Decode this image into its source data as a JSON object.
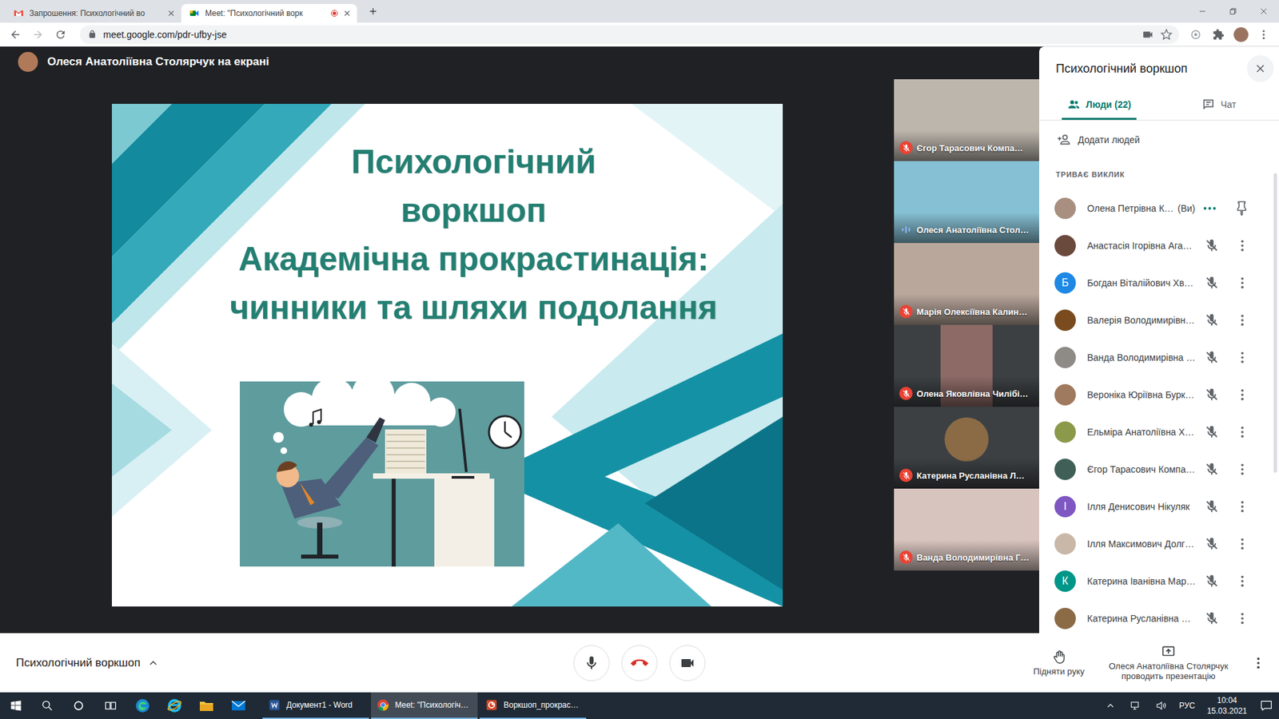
{
  "browser": {
    "tabs": [
      {
        "label": "Запрошення: Психологічний во",
        "kind": "gmail",
        "selected": false,
        "recording": false
      },
      {
        "label": "Meet: \"Психологічний ворк",
        "kind": "meet",
        "selected": true,
        "recording": true
      }
    ],
    "url": "meet.google.com/pdr-ufby-jse"
  },
  "meeting": {
    "presenter_label": "Олеся Анатоліївна Столярчук на екрані",
    "presenter_color": "#b07a5a"
  },
  "slide": {
    "title_lines": [
      "Психологічний",
      "воркшоп",
      "Академічна прокрастинація:",
      "чинники та шляхи подолання"
    ]
  },
  "tiles": [
    {
      "name": "Єгор Тарасович Компа…",
      "kind": "video",
      "muted": true,
      "color": "#bdb6ad"
    },
    {
      "name": "Олеся Анатоліївна Стол…",
      "kind": "video",
      "muted": false,
      "color": "#86c0d4"
    },
    {
      "name": "Марія Олексіївна Калин…",
      "kind": "video",
      "muted": true,
      "color": "#b9a79c"
    },
    {
      "name": "Олена Яковлівна Чилібі…",
      "kind": "portrait",
      "muted": true,
      "color": "#8d6a66"
    },
    {
      "name": "Катерина Русланівна Л…",
      "kind": "avatar",
      "muted": true,
      "color": "#8b6b45"
    },
    {
      "name": "Ванда Володимирівна Г…",
      "kind": "video",
      "muted": true,
      "color": "#d8c4be"
    }
  ],
  "panel": {
    "title": "Психологічний воркшоп",
    "tabs": [
      {
        "label": "Люди (22)",
        "kind": "people",
        "selected": true
      },
      {
        "label": "Чат",
        "kind": "chat",
        "selected": false
      }
    ],
    "add_people": "Додати людей",
    "section": "ТРИВАЄ ВИКЛИК",
    "participants": [
      {
        "name": "Олена Петрівна К…",
        "suffix": "(Ви)",
        "kind": "self",
        "color": "#a88f7f"
      },
      {
        "name": "Анастасія Ігорівна Ага…",
        "kind": "member",
        "muted": true,
        "color": "#6b4a3e"
      },
      {
        "name": "Богдан Віталійович Хв…",
        "kind": "member",
        "muted": true,
        "letter": "Б",
        "color": "#1e88e5"
      },
      {
        "name": "Валерія Володимирівн…",
        "kind": "member",
        "muted": true,
        "color": "#7a4b1e"
      },
      {
        "name": "Ванда Володимирівна …",
        "kind": "member",
        "muted": true,
        "color": "#8e8a86"
      },
      {
        "name": "Вероніка Юріївна Бурк…",
        "kind": "member",
        "muted": true,
        "color": "#a07a5e"
      },
      {
        "name": "Ельміра Анатоліївна Х…",
        "kind": "member",
        "muted": true,
        "color": "#8a9a4a"
      },
      {
        "name": "Єгор Тарасович Компа…",
        "kind": "member",
        "muted": true,
        "color": "#3f5f57"
      },
      {
        "name": "Ілля Денисович Нікуляк",
        "kind": "member",
        "muted": true,
        "letter": "І",
        "color": "#7e57c2"
      },
      {
        "name": "Ілля Максимович Долг…",
        "kind": "member",
        "muted": true,
        "color": "#c9b8a8"
      },
      {
        "name": "Катерина Іванівна Мар…",
        "kind": "member",
        "muted": true,
        "letter": "К",
        "color": "#009688"
      },
      {
        "name": "Катерина Русланівна …",
        "kind": "member",
        "muted": true,
        "color": "#8b6b45"
      }
    ]
  },
  "controls": {
    "meeting_title": "Психологічний воркшоп",
    "mic_muted": false,
    "camera_off": false,
    "raise_hand": "Підняти руку",
    "presenting": "Олеся Анатоліївна Столярчук проводить презентацію"
  },
  "taskbar": {
    "apps": [
      {
        "label": "Документ1 - Word",
        "kind": "word",
        "selected": false
      },
      {
        "label": "Meet: \"Психологіч…",
        "kind": "chrome",
        "selected": true
      },
      {
        "label": "Воркшоп_прокрас…",
        "kind": "powerpoint",
        "selected": false
      }
    ],
    "lang": "РУС",
    "time": "10:04",
    "date": "15.03.2021"
  }
}
